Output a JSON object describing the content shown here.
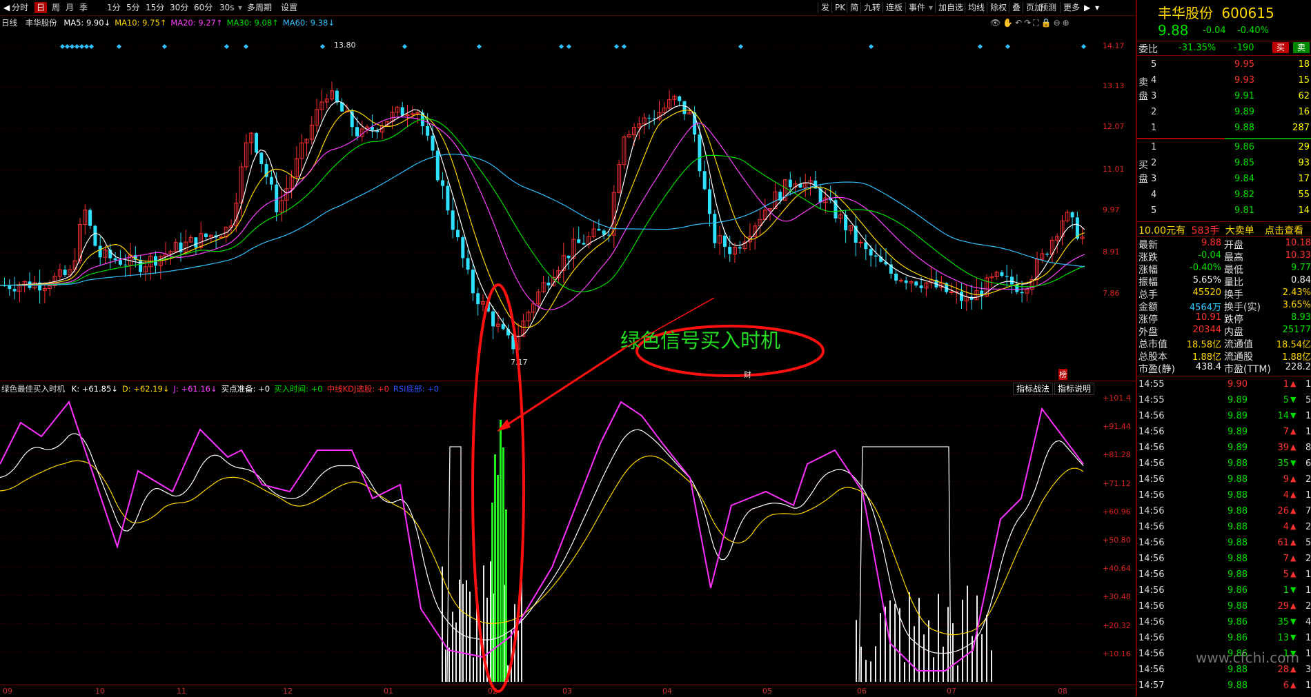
{
  "toolbar": {
    "left_items": [
      "分时",
      "日",
      "周",
      "月",
      "季",
      "1分",
      "5分",
      "15分",
      "30分",
      "60分",
      "30s",
      "多周期",
      "设置"
    ],
    "active_index": 1,
    "right_items": [
      "发",
      "PK",
      "简",
      "九转",
      "连板",
      "事件",
      "加自选",
      "均线",
      "除权",
      "叠",
      "页加",
      "预测",
      "更多"
    ]
  },
  "main_chart": {
    "period_label": "日线",
    "stock_name": "丰华股份",
    "ma_legend": [
      {
        "text": "MA5: 9.90↓",
        "color": "#ffffff"
      },
      {
        "text": "MA10: 9.75↑",
        "color": "#ffd800"
      },
      {
        "text": "MA20: 9.27↑",
        "color": "#ff40ff"
      },
      {
        "text": "MA30: 9.08↑",
        "color": "#00e000"
      },
      {
        "text": "MA60: 9.38↓",
        "color": "#30c0ff"
      }
    ],
    "price_axis": [
      "14.17",
      "13.13",
      "12.07",
      "11.01",
      "9.97",
      "8.91",
      "7.86"
    ],
    "high_label": "13.80",
    "low_label": "7.17",
    "annotation": "绿色信号买入时机",
    "marker_cai": "财",
    "marker_bang": "榜"
  },
  "indicator": {
    "name": "绿色最佳买入时机",
    "legend": [
      {
        "text": "K: +61.85↓",
        "color": "#ffffff"
      },
      {
        "text": "D: +62.19↓",
        "color": "#ffd800"
      },
      {
        "text": "J: +61.16↓",
        "color": "#ff40ff"
      },
      {
        "text": "买点准备: +0",
        "color": "#ffffff"
      },
      {
        "text": "买入时间: +0",
        "color": "#00e000"
      },
      {
        "text": "中线KDJ选股: +0",
        "color": "#ff3030"
      },
      {
        "text": "RSI底部: +0",
        "color": "#3050ff"
      }
    ],
    "btn_tactics": "指标战法",
    "btn_help": "指标说明",
    "axis": [
      "+101.4",
      "+91.44",
      "+81.28",
      "+71.12",
      "+60.96",
      "+50.80",
      "+40.64",
      "+30.48",
      "+20.32",
      "+10.16"
    ]
  },
  "x_axis": [
    "09",
    "10",
    "11",
    "12",
    "01",
    "02",
    "03",
    "04",
    "05",
    "06",
    "07",
    "08"
  ],
  "chart_data": {
    "type": "candlestick",
    "series": [
      {
        "name": "MA5",
        "values": [
          9.9
        ]
      },
      {
        "name": "MA10",
        "values": [
          9.75
        ]
      },
      {
        "name": "MA20",
        "values": [
          9.27
        ]
      },
      {
        "name": "MA30",
        "values": [
          9.08
        ]
      },
      {
        "name": "MA60",
        "values": [
          9.38
        ]
      }
    ],
    "ylim": [
      7.17,
      14.17
    ],
    "highest": 13.8,
    "lowest": 7.17,
    "indicator_series": [
      {
        "name": "K",
        "last": 61.85
      },
      {
        "name": "D",
        "last": 62.19
      },
      {
        "name": "J",
        "last": 61.16
      }
    ],
    "indicator_ylim": [
      10.16,
      101.4
    ]
  },
  "quote": {
    "name": "丰华股份",
    "code": "600615",
    "price": "9.88",
    "change": "-0.04",
    "change_pct": "-0.40%",
    "weibi_label": "委比",
    "weibi": "-31.35%",
    "weicha": "-190",
    "buy_btn": "买",
    "sell_btn": "卖",
    "sell_label": "卖盘",
    "buy_label": "买盘",
    "asks": [
      {
        "level": "5",
        "price": "9.95",
        "vol": "18"
      },
      {
        "level": "4",
        "price": "9.93",
        "vol": "15"
      },
      {
        "level": "3",
        "price": "9.91",
        "vol": "62"
      },
      {
        "level": "2",
        "price": "9.89",
        "vol": "16"
      },
      {
        "level": "1",
        "price": "9.88",
        "vol": "287"
      }
    ],
    "bids": [
      {
        "level": "1",
        "price": "9.86",
        "vol": "29"
      },
      {
        "level": "2",
        "price": "9.85",
        "vol": "93"
      },
      {
        "level": "3",
        "price": "9.84",
        "vol": "17"
      },
      {
        "level": "4",
        "price": "9.82",
        "vol": "55"
      },
      {
        "level": "5",
        "price": "9.81",
        "vol": "14"
      }
    ],
    "big_order_a": "10.00元有",
    "big_order_b": "583手",
    "big_order_c": "大卖单",
    "big_order_link": "点击查看",
    "stats": [
      {
        "l1": "最新",
        "v1": "9.88",
        "c1": "#ff3030",
        "l2": "开盘",
        "v2": "10.18",
        "c2": "#ff3030"
      },
      {
        "l1": "涨跌",
        "v1": "-0.04",
        "c1": "#00e000",
        "l2": "最高",
        "v2": "10.33",
        "c2": "#ff3030"
      },
      {
        "l1": "涨幅",
        "v1": "-0.40%",
        "c1": "#00e000",
        "l2": "最低",
        "v2": "9.77",
        "c2": "#00e000"
      },
      {
        "l1": "振幅",
        "v1": "5.65%",
        "c1": "#eeeeee",
        "l2": "量比",
        "v2": "0.84",
        "c2": "#eeeeee"
      },
      {
        "l1": "总手",
        "v1": "45520",
        "c1": "#ffd800",
        "l2": "换手",
        "v2": "2.43%",
        "c2": "#ffd800"
      },
      {
        "l1": "金额",
        "v1": "4564万",
        "c1": "#3cf",
        "l2": "换手(实)",
        "v2": "3.65%",
        "c2": "#ffd800"
      },
      {
        "l1": "涨停",
        "v1": "10.91",
        "c1": "#ff3030",
        "l2": "跌停",
        "v2": "8.93",
        "c2": "#00e000"
      },
      {
        "l1": "外盘",
        "v1": "20344",
        "c1": "#ff3030",
        "l2": "内盘",
        "v2": "25177",
        "c2": "#00e000"
      },
      {
        "l1": "总市值",
        "v1": "18.58亿",
        "c1": "#ffd800",
        "l2": "流通值",
        "v2": "18.54亿",
        "c2": "#ffd800"
      },
      {
        "l1": "总股本",
        "v1": "1.88亿",
        "c1": "#ffd800",
        "l2": "流通股",
        "v2": "1.88亿",
        "c2": "#ffd800"
      },
      {
        "l1": "市盈(静)",
        "v1": "438.4",
        "c1": "#eeeeee",
        "l2": "市盈(TTM)",
        "v2": "228.2",
        "c2": "#eeeeee"
      }
    ],
    "ticks": [
      {
        "t": "14:55",
        "p": "9.90",
        "v": "1",
        "d": "up",
        "x": "1"
      },
      {
        "t": "14:55",
        "p": "9.89",
        "v": "5",
        "d": "down",
        "x": "5"
      },
      {
        "t": "14:56",
        "p": "9.89",
        "v": "14",
        "d": "down",
        "x": "1"
      },
      {
        "t": "14:56",
        "p": "9.89",
        "v": "7",
        "d": "up",
        "x": "1"
      },
      {
        "t": "14:56",
        "p": "9.89",
        "v": "39",
        "d": "up",
        "x": "8"
      },
      {
        "t": "14:56",
        "p": "9.88",
        "v": "35",
        "d": "down",
        "x": "6"
      },
      {
        "t": "14:56",
        "p": "9.88",
        "v": "9",
        "d": "up",
        "x": "2"
      },
      {
        "t": "14:56",
        "p": "9.88",
        "v": "4",
        "d": "up",
        "x": "1"
      },
      {
        "t": "14:56",
        "p": "9.88",
        "v": "26",
        "d": "up",
        "x": "7"
      },
      {
        "t": "14:56",
        "p": "9.88",
        "v": "4",
        "d": "up",
        "x": "2"
      },
      {
        "t": "14:56",
        "p": "9.88",
        "v": "61",
        "d": "up",
        "x": "5"
      },
      {
        "t": "14:56",
        "p": "9.88",
        "v": "7",
        "d": "up",
        "x": "2"
      },
      {
        "t": "14:56",
        "p": "9.88",
        "v": "5",
        "d": "up",
        "x": "1"
      },
      {
        "t": "14:56",
        "p": "9.86",
        "v": "1",
        "d": "down",
        "x": "1"
      },
      {
        "t": "14:56",
        "p": "9.88",
        "v": "29",
        "d": "up",
        "x": "2"
      },
      {
        "t": "14:56",
        "p": "9.86",
        "v": "35",
        "d": "down",
        "x": "4"
      },
      {
        "t": "14:56",
        "p": "9.86",
        "v": "13",
        "d": "down",
        "x": "1"
      },
      {
        "t": "14:56",
        "p": "9.86",
        "v": "1",
        "d": "down",
        "x": "1"
      },
      {
        "t": "14:56",
        "p": "9.88",
        "v": "28",
        "d": "up",
        "x": "3"
      },
      {
        "t": "14:57",
        "p": "9.88",
        "v": "6",
        "d": "up",
        "x": "1"
      }
    ],
    "watermark": "www.cfchi.com"
  }
}
